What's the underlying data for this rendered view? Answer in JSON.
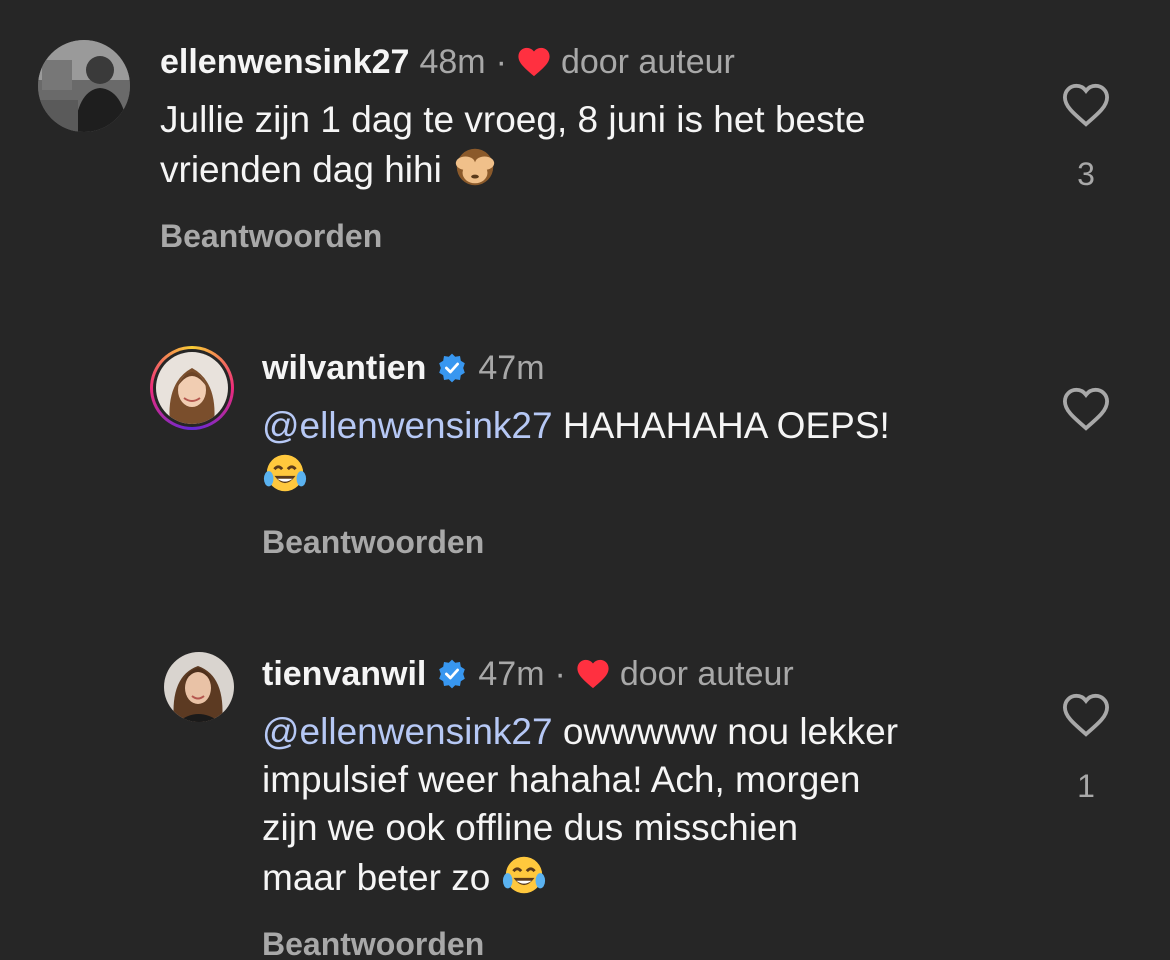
{
  "comments": [
    {
      "username": "ellenwensink27",
      "time": "48m",
      "separator": "·",
      "by_author": "door auteur",
      "text": "Jullie zijn 1 dag te vroeg, 8 juni is het beste\nvrienden dag hihi ",
      "emoji": "see-no-evil-monkey",
      "reply_label": "Beantwoorden",
      "like_count": "3",
      "verified": false
    },
    {
      "username": "wilvantien",
      "time": "47m",
      "mention": "@ellenwensink27",
      "text": " HAHAHAHA OEPS!\n",
      "emoji": "face-with-tears-of-joy",
      "reply_label": "Beantwoorden",
      "verified": true
    },
    {
      "username": "tienvanwil",
      "time": "47m",
      "separator": "·",
      "by_author": "door auteur",
      "mention": "@ellenwensink27",
      "text": " owwwww nou lekker\nimpulsief weer hahaha! Ach, morgen\nzijn we ook offline dus misschien\nmaar beter zo ",
      "emoji": "face-with-tears-of-joy",
      "reply_label": "Beantwoorden",
      "like_count": "1",
      "verified": true
    }
  ],
  "colors": {
    "background": "#262626",
    "text": "#f5f5f5",
    "muted": "#a8a8a8",
    "heart_red": "#ff3040",
    "verified_blue": "#3897f0",
    "mention": "#b6c8f5"
  }
}
